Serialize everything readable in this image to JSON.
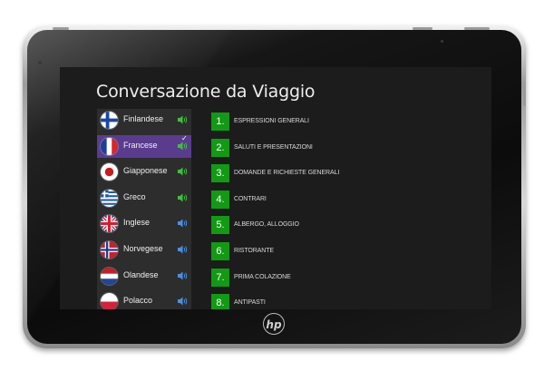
{
  "app": {
    "title": "Conversazione da Viaggio",
    "device_logo": "hp"
  },
  "languages": [
    {
      "label": "Finlandese",
      "flag": "finland-flag",
      "selected": false,
      "speaker_color": "#3fbf3f"
    },
    {
      "label": "Francese",
      "flag": "france-flag",
      "selected": true,
      "speaker_color": "#3fbf3f"
    },
    {
      "label": "Giapponese",
      "flag": "japan-flag",
      "selected": false,
      "speaker_color": "#3fbf3f"
    },
    {
      "label": "Greco",
      "flag": "greece-flag",
      "selected": false,
      "speaker_color": "#3fbf3f"
    },
    {
      "label": "Inglese",
      "flag": "uk-flag",
      "selected": false,
      "speaker_color": "#4a90e2"
    },
    {
      "label": "Norvegese",
      "flag": "norway-flag",
      "selected": false,
      "speaker_color": "#4a90e2"
    },
    {
      "label": "Olandese",
      "flag": "netherlands-flag",
      "selected": false,
      "speaker_color": "#4a90e2"
    },
    {
      "label": "Polacco",
      "flag": "poland-flag",
      "selected": false,
      "speaker_color": "#4a90e2"
    }
  ],
  "topics": [
    {
      "number": "1.",
      "label": "ESPRESSIONI GENERALI"
    },
    {
      "number": "2.",
      "label": "SALUTI E PRESENTAZIONI"
    },
    {
      "number": "3.",
      "label": "DOMANDE E RICHIESTE GENERALI"
    },
    {
      "number": "4.",
      "label": "CONTRARI"
    },
    {
      "number": "5.",
      "label": "ALBERGO, ALLOGGIO"
    },
    {
      "number": "6.",
      "label": "RISTORANTE"
    },
    {
      "number": "7.",
      "label": "PRIMA COLAZIONE"
    },
    {
      "number": "8.",
      "label": "ANTIPASTI"
    }
  ],
  "colors": {
    "screen_bg": "#1c1c1c",
    "panel_bg": "#2d2d2d",
    "selected_bg": "#5a3c8f",
    "tile_green": "#129a14"
  }
}
